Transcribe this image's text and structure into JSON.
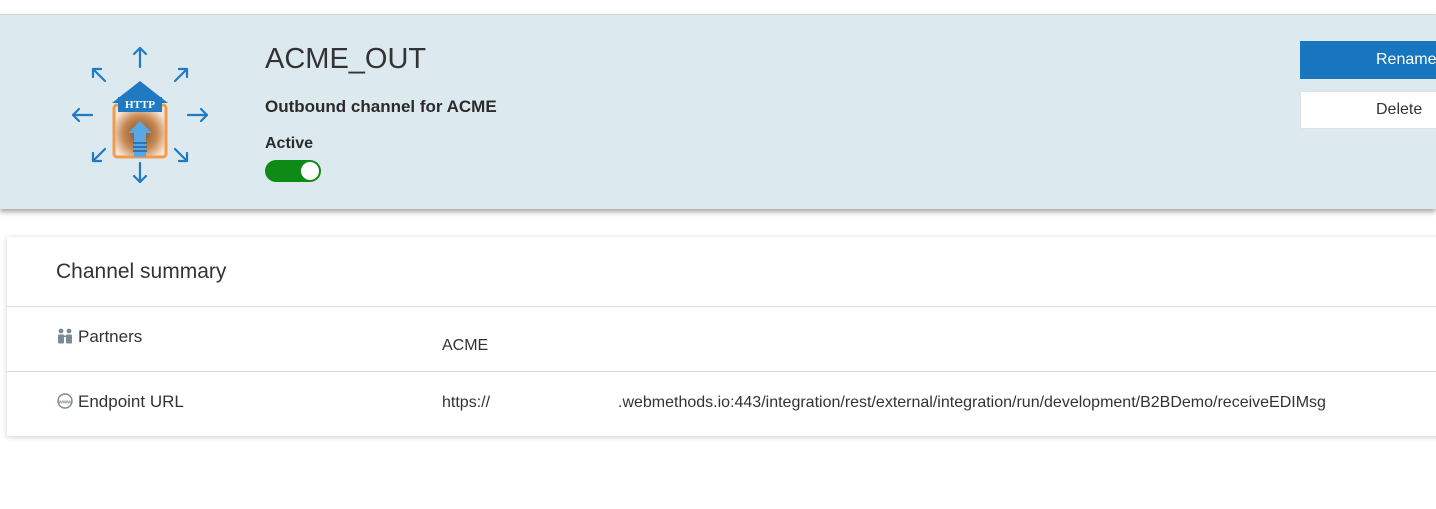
{
  "channel": {
    "name": "ACME_OUT",
    "description": "Outbound channel for ACME",
    "status_label": "Active",
    "active": true,
    "icon": "http-outbound-channel-icon",
    "icon_badge_text": "HTTP"
  },
  "actions": {
    "rename_label": "Rename",
    "delete_label": "Delete"
  },
  "summary": {
    "title": "Channel summary",
    "rows": [
      {
        "label": "Partners",
        "icon": "partners-icon",
        "value": "ACME"
      },
      {
        "label": "Endpoint URL",
        "icon": "www-globe-icon",
        "value_scheme": "https://",
        "value_path": ".webmethods.io:443/integration/rest/external/integration/run/development/B2BDemo/receiveEDIMsg"
      }
    ]
  },
  "colors": {
    "header_background": "#dce9ef",
    "primary_button": "#1776be",
    "toggle_on": "#0e8a16",
    "icon_accent": "#1f7ac2",
    "icon_orange": "#f39a4b"
  }
}
